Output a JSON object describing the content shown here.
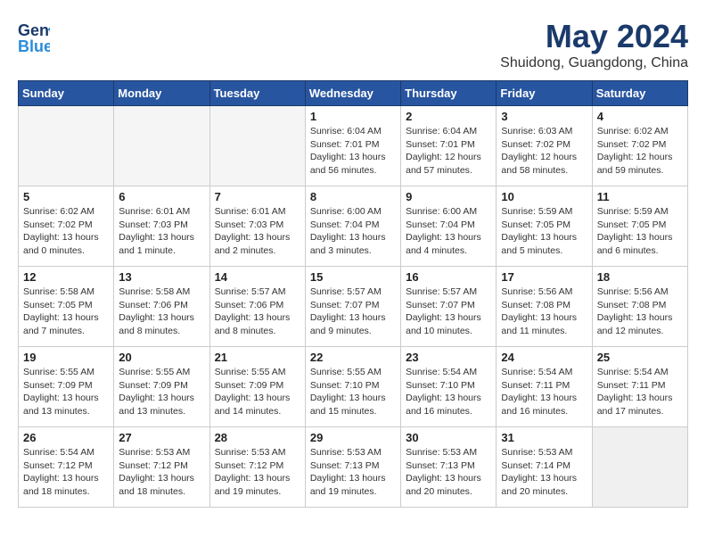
{
  "header": {
    "logo_line1": "General",
    "logo_line2": "Blue",
    "month": "May 2024",
    "location": "Shuidong, Guangdong, China"
  },
  "weekdays": [
    "Sunday",
    "Monday",
    "Tuesday",
    "Wednesday",
    "Thursday",
    "Friday",
    "Saturday"
  ],
  "weeks": [
    [
      {
        "num": "",
        "info": ""
      },
      {
        "num": "",
        "info": ""
      },
      {
        "num": "",
        "info": ""
      },
      {
        "num": "1",
        "info": "Sunrise: 6:04 AM\nSunset: 7:01 PM\nDaylight: 13 hours\nand 56 minutes."
      },
      {
        "num": "2",
        "info": "Sunrise: 6:04 AM\nSunset: 7:01 PM\nDaylight: 12 hours\nand 57 minutes."
      },
      {
        "num": "3",
        "info": "Sunrise: 6:03 AM\nSunset: 7:02 PM\nDaylight: 12 hours\nand 58 minutes."
      },
      {
        "num": "4",
        "info": "Sunrise: 6:02 AM\nSunset: 7:02 PM\nDaylight: 12 hours\nand 59 minutes."
      }
    ],
    [
      {
        "num": "5",
        "info": "Sunrise: 6:02 AM\nSunset: 7:02 PM\nDaylight: 13 hours\nand 0 minutes."
      },
      {
        "num": "6",
        "info": "Sunrise: 6:01 AM\nSunset: 7:03 PM\nDaylight: 13 hours\nand 1 minute."
      },
      {
        "num": "7",
        "info": "Sunrise: 6:01 AM\nSunset: 7:03 PM\nDaylight: 13 hours\nand 2 minutes."
      },
      {
        "num": "8",
        "info": "Sunrise: 6:00 AM\nSunset: 7:04 PM\nDaylight: 13 hours\nand 3 minutes."
      },
      {
        "num": "9",
        "info": "Sunrise: 6:00 AM\nSunset: 7:04 PM\nDaylight: 13 hours\nand 4 minutes."
      },
      {
        "num": "10",
        "info": "Sunrise: 5:59 AM\nSunset: 7:05 PM\nDaylight: 13 hours\nand 5 minutes."
      },
      {
        "num": "11",
        "info": "Sunrise: 5:59 AM\nSunset: 7:05 PM\nDaylight: 13 hours\nand 6 minutes."
      }
    ],
    [
      {
        "num": "12",
        "info": "Sunrise: 5:58 AM\nSunset: 7:05 PM\nDaylight: 13 hours\nand 7 minutes."
      },
      {
        "num": "13",
        "info": "Sunrise: 5:58 AM\nSunset: 7:06 PM\nDaylight: 13 hours\nand 8 minutes."
      },
      {
        "num": "14",
        "info": "Sunrise: 5:57 AM\nSunset: 7:06 PM\nDaylight: 13 hours\nand 8 minutes."
      },
      {
        "num": "15",
        "info": "Sunrise: 5:57 AM\nSunset: 7:07 PM\nDaylight: 13 hours\nand 9 minutes."
      },
      {
        "num": "16",
        "info": "Sunrise: 5:57 AM\nSunset: 7:07 PM\nDaylight: 13 hours\nand 10 minutes."
      },
      {
        "num": "17",
        "info": "Sunrise: 5:56 AM\nSunset: 7:08 PM\nDaylight: 13 hours\nand 11 minutes."
      },
      {
        "num": "18",
        "info": "Sunrise: 5:56 AM\nSunset: 7:08 PM\nDaylight: 13 hours\nand 12 minutes."
      }
    ],
    [
      {
        "num": "19",
        "info": "Sunrise: 5:55 AM\nSunset: 7:09 PM\nDaylight: 13 hours\nand 13 minutes."
      },
      {
        "num": "20",
        "info": "Sunrise: 5:55 AM\nSunset: 7:09 PM\nDaylight: 13 hours\nand 13 minutes."
      },
      {
        "num": "21",
        "info": "Sunrise: 5:55 AM\nSunset: 7:09 PM\nDaylight: 13 hours\nand 14 minutes."
      },
      {
        "num": "22",
        "info": "Sunrise: 5:55 AM\nSunset: 7:10 PM\nDaylight: 13 hours\nand 15 minutes."
      },
      {
        "num": "23",
        "info": "Sunrise: 5:54 AM\nSunset: 7:10 PM\nDaylight: 13 hours\nand 16 minutes."
      },
      {
        "num": "24",
        "info": "Sunrise: 5:54 AM\nSunset: 7:11 PM\nDaylight: 13 hours\nand 16 minutes."
      },
      {
        "num": "25",
        "info": "Sunrise: 5:54 AM\nSunset: 7:11 PM\nDaylight: 13 hours\nand 17 minutes."
      }
    ],
    [
      {
        "num": "26",
        "info": "Sunrise: 5:54 AM\nSunset: 7:12 PM\nDaylight: 13 hours\nand 18 minutes."
      },
      {
        "num": "27",
        "info": "Sunrise: 5:53 AM\nSunset: 7:12 PM\nDaylight: 13 hours\nand 18 minutes."
      },
      {
        "num": "28",
        "info": "Sunrise: 5:53 AM\nSunset: 7:12 PM\nDaylight: 13 hours\nand 19 minutes."
      },
      {
        "num": "29",
        "info": "Sunrise: 5:53 AM\nSunset: 7:13 PM\nDaylight: 13 hours\nand 19 minutes."
      },
      {
        "num": "30",
        "info": "Sunrise: 5:53 AM\nSunset: 7:13 PM\nDaylight: 13 hours\nand 20 minutes."
      },
      {
        "num": "31",
        "info": "Sunrise: 5:53 AM\nSunset: 7:14 PM\nDaylight: 13 hours\nand 20 minutes."
      },
      {
        "num": "",
        "info": ""
      }
    ]
  ]
}
